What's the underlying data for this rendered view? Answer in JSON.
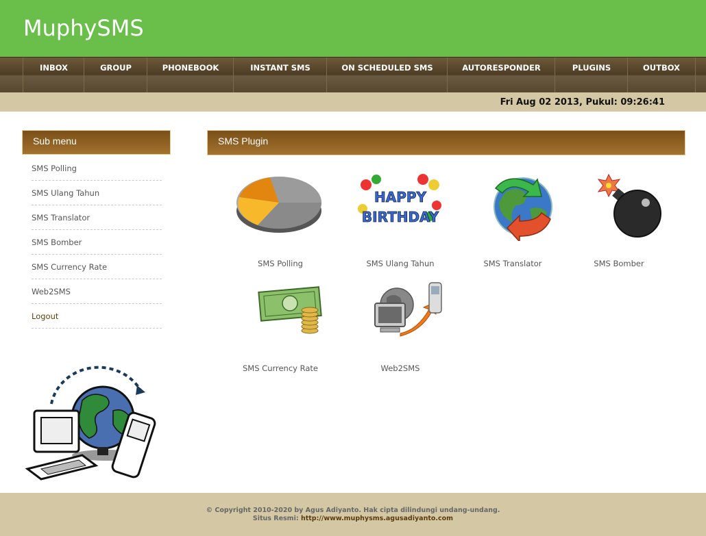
{
  "app": {
    "title": "MuphySMS"
  },
  "nav": {
    "items": [
      "INBOX",
      "GROUP",
      "PHONEBOOK",
      "INSTANT SMS",
      "ON SCHEDULED SMS",
      "AUTORESPONDER",
      "PLUGINS",
      "OUTBOX"
    ]
  },
  "datebar": {
    "text": "Fri Aug 02 2013, Pukul: 09:26:41"
  },
  "sidebar": {
    "title": "Sub menu",
    "items": [
      "SMS Polling",
      "SMS Ulang Tahun",
      "SMS Translator",
      "SMS Bomber",
      "SMS Currency Rate",
      "Web2SMS",
      "Logout"
    ]
  },
  "main": {
    "title": "SMS Plugin",
    "plugins": [
      {
        "label": "SMS Polling",
        "icon": "pie-chart-icon"
      },
      {
        "label": "SMS Ulang Tahun",
        "icon": "happy-birthday-icon"
      },
      {
        "label": "SMS Translator",
        "icon": "globe-arrows-icon"
      },
      {
        "label": "SMS Bomber",
        "icon": "bomb-icon"
      },
      {
        "label": "SMS Currency Rate",
        "icon": "money-icon"
      },
      {
        "label": "Web2SMS",
        "icon": "computer-to-phone-icon"
      }
    ]
  },
  "footer": {
    "copyright": "© Copyright 2010-2020 by Agus Adiyanto. Hak cipta dilindungi undang-undang.",
    "site_label": "Situs Resmi:",
    "site_url": "http://www.muphysms.agusadiyanto.com"
  },
  "colors": {
    "header": "#6abf4b",
    "nav": "#4d3c24",
    "datebar": "#d4c8a4",
    "panel_header": "#8a5d22"
  }
}
